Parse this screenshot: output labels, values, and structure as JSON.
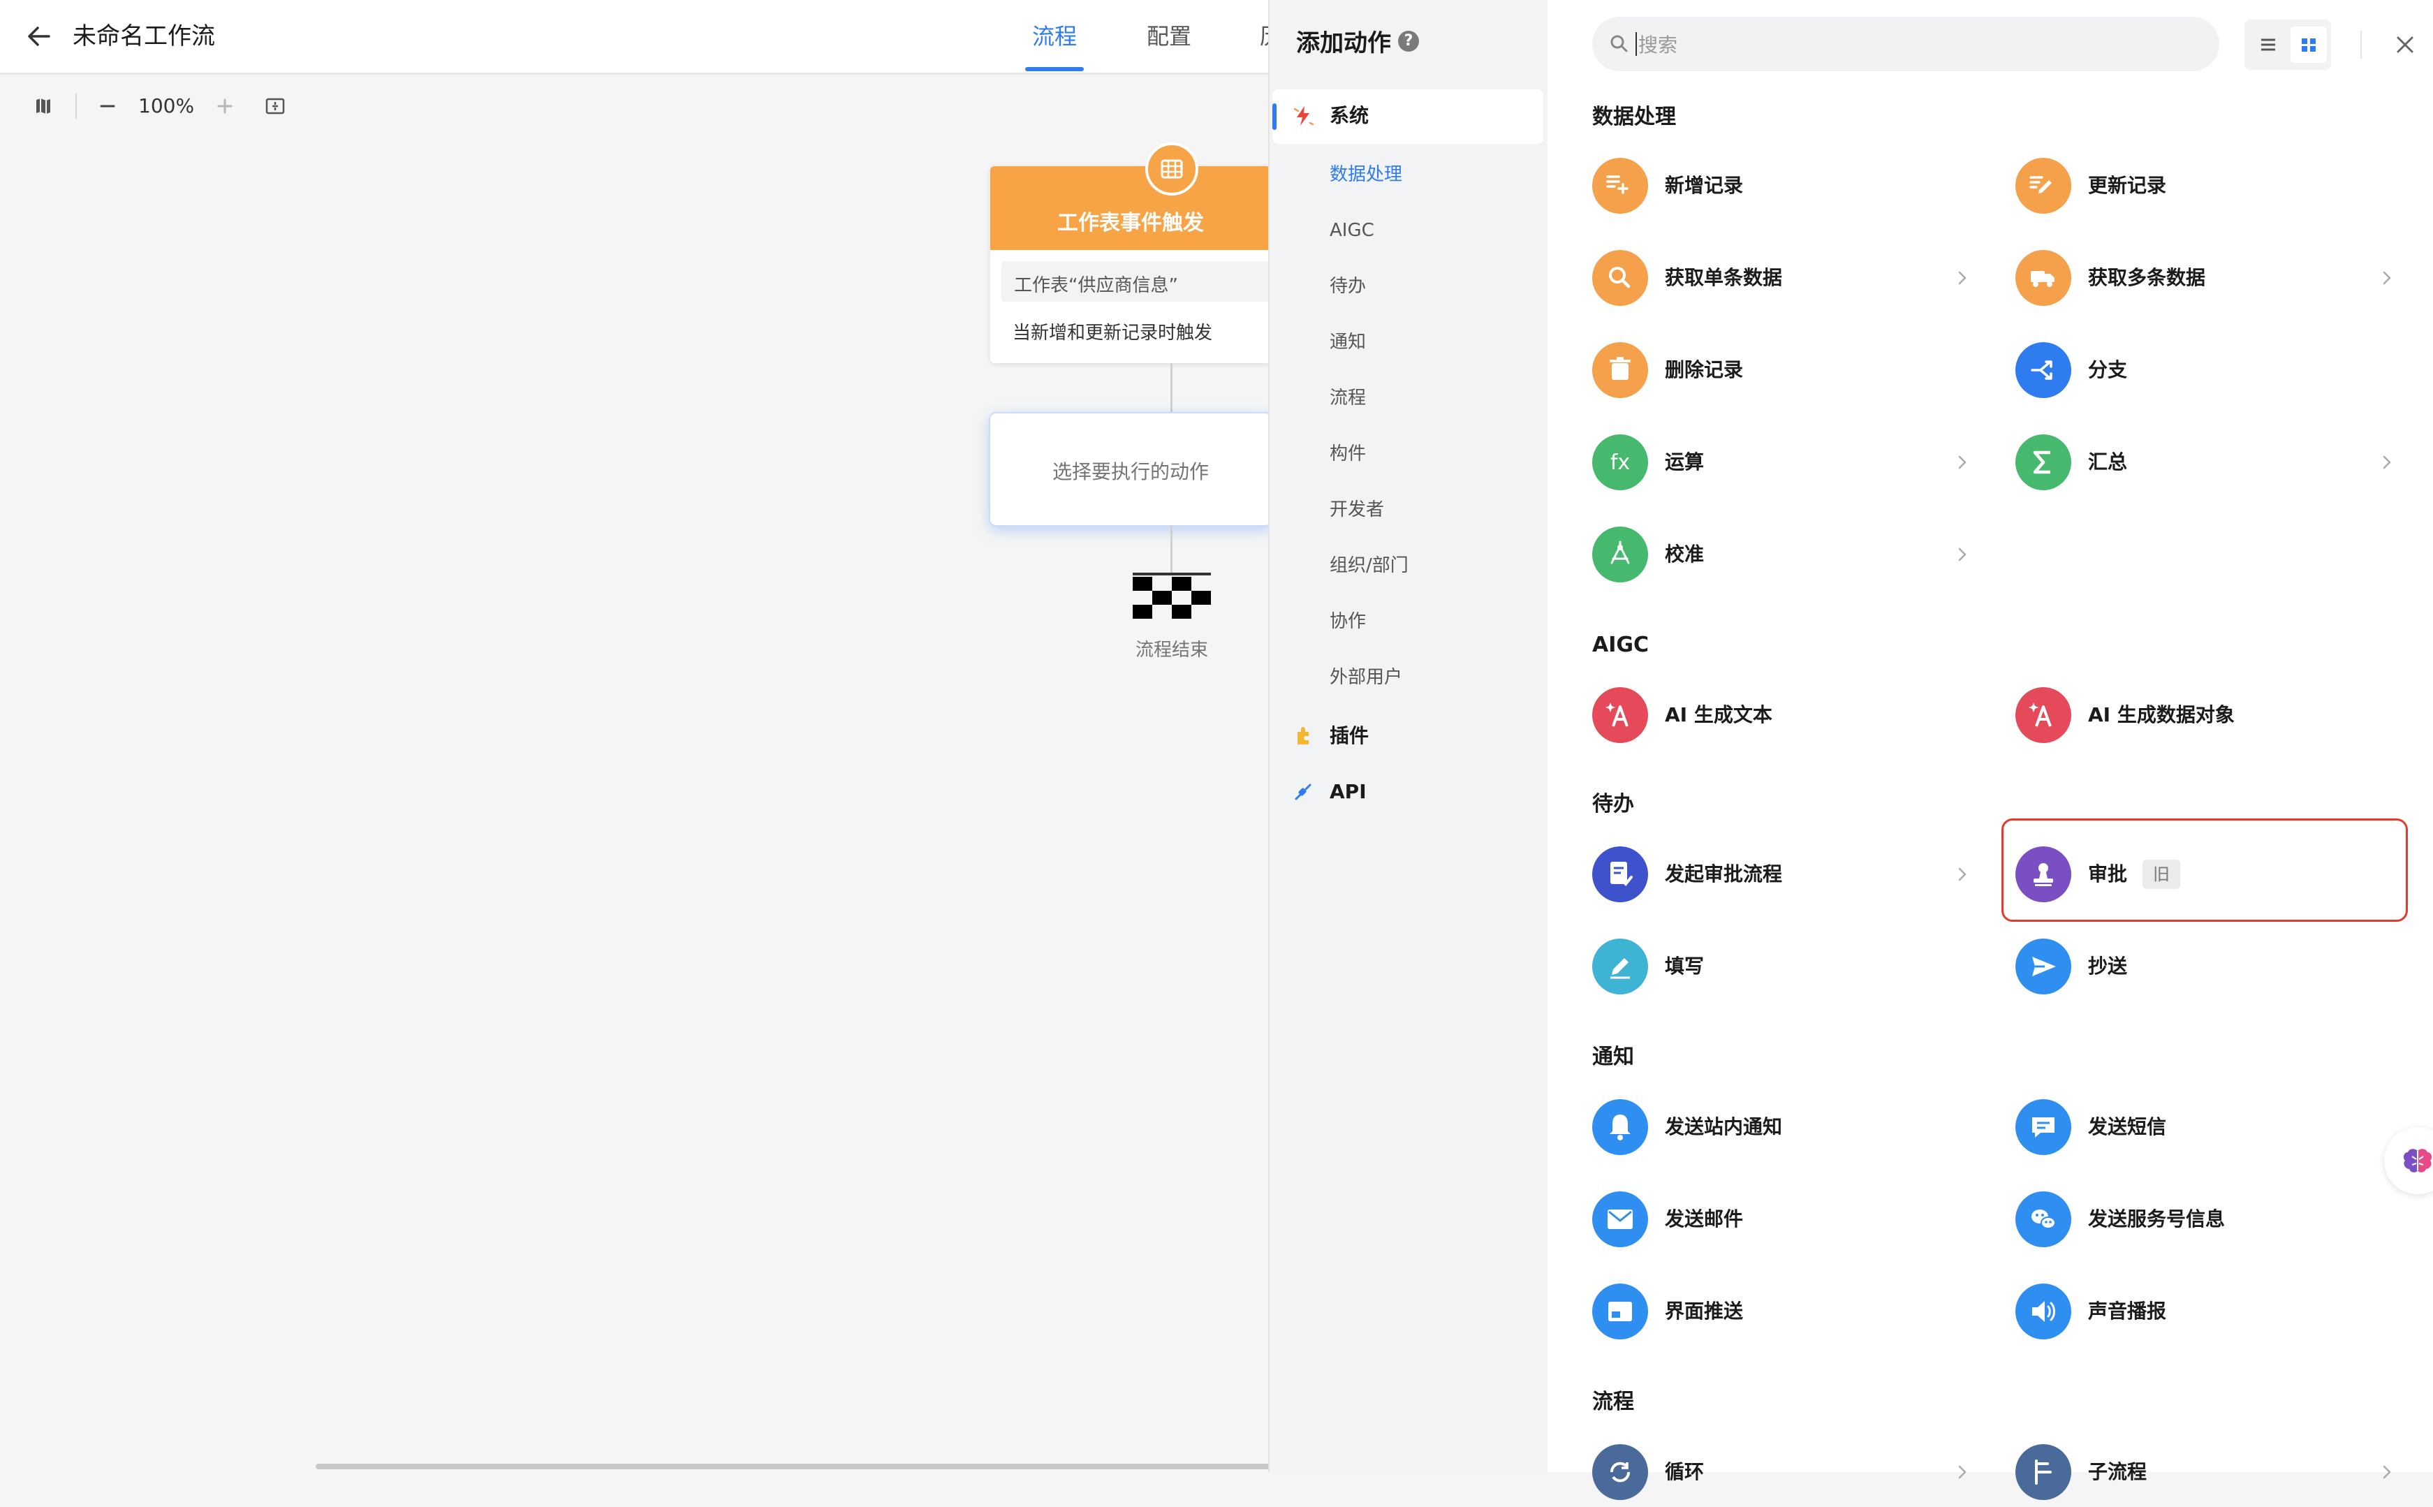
{
  "header": {
    "title": "未命名工作流",
    "tabs": [
      {
        "label": "流程",
        "active": true
      },
      {
        "label": "配置",
        "active": false
      },
      {
        "label": "历",
        "active": false
      }
    ]
  },
  "toolbar": {
    "zoom": "100%"
  },
  "canvas": {
    "trigger": {
      "title": "工作表事件触发",
      "worksheet": "工作表“供应商信息”",
      "condition": "当新增和更新记录时触发"
    },
    "placeholder": "选择要执行的动作",
    "end_label": "流程结束"
  },
  "category_panel": {
    "title": "添加动作",
    "groups": [
      {
        "label": "系统",
        "icon": "system-icon",
        "active": true
      },
      {
        "label": "插件",
        "icon": "plugin-icon"
      },
      {
        "label": "API",
        "icon": "api-icon"
      }
    ],
    "subcategories": [
      "数据处理",
      "AIGC",
      "待办",
      "通知",
      "流程",
      "构件",
      "开发者",
      "组织/部门",
      "协作",
      "外部用户"
    ],
    "active_sub": "数据处理"
  },
  "search": {
    "placeholder": "搜索"
  },
  "sections": [
    {
      "title": "数据处理",
      "items": [
        {
          "label": "新增记录",
          "icon": "add-record-icon",
          "color": "#f5a04a"
        },
        {
          "label": "更新记录",
          "icon": "update-record-icon",
          "color": "#f5a04a"
        },
        {
          "label": "获取单条数据",
          "icon": "search-icon",
          "color": "#f5a04a",
          "chevron": true
        },
        {
          "label": "获取多条数据",
          "icon": "truck-icon",
          "color": "#f5a04a",
          "chevron": true
        },
        {
          "label": "删除记录",
          "icon": "trash-icon",
          "color": "#f5a04a"
        },
        {
          "label": "分支",
          "icon": "branch-icon",
          "color": "#2f7bf0"
        },
        {
          "label": "运算",
          "icon": "fx-icon",
          "color": "#47b96e",
          "chevron": true
        },
        {
          "label": "汇总",
          "icon": "sigma-icon",
          "color": "#47b96e",
          "chevron": true
        },
        {
          "label": "校准",
          "icon": "calibrate-icon",
          "color": "#47b96e",
          "chevron": true
        }
      ]
    },
    {
      "title": "AIGC",
      "items": [
        {
          "label": "AI 生成文本",
          "icon": "ai-text-icon",
          "color": "#e54a5a"
        },
        {
          "label": "AI 生成数据对象",
          "icon": "ai-object-icon",
          "color": "#e54a5a"
        }
      ]
    },
    {
      "title": "待办",
      "items": [
        {
          "label": "发起审批流程",
          "icon": "approval-flow-icon",
          "color": "#3e52cc",
          "chevron": true
        },
        {
          "label": "审批",
          "icon": "stamp-icon",
          "color": "#7b4fc4",
          "badge": "旧"
        },
        {
          "label": "填写",
          "icon": "pencil-icon",
          "color": "#3fb3d4"
        },
        {
          "label": "抄送",
          "icon": "send-icon",
          "color": "#2f8ff0"
        }
      ]
    },
    {
      "title": "通知",
      "items": [
        {
          "label": "发送站内通知",
          "icon": "bell-icon",
          "color": "#2f8ff0"
        },
        {
          "label": "发送短信",
          "icon": "sms-icon",
          "color": "#2f8ff0"
        },
        {
          "label": "发送邮件",
          "icon": "mail-icon",
          "color": "#2f8ff0"
        },
        {
          "label": "发送服务号信息",
          "icon": "wechat-icon",
          "color": "#2f8ff0"
        },
        {
          "label": "界面推送",
          "icon": "push-icon",
          "color": "#2f8ff0"
        },
        {
          "label": "声音播报",
          "icon": "speaker-icon",
          "color": "#2f8ff0"
        }
      ]
    },
    {
      "title": "流程",
      "items": [
        {
          "label": "循环",
          "icon": "loop-icon",
          "color": "#4a6a9a",
          "chevron": true
        },
        {
          "label": "子流程",
          "icon": "subflow-icon",
          "color": "#4a6a9a",
          "chevron": true
        }
      ]
    }
  ]
}
